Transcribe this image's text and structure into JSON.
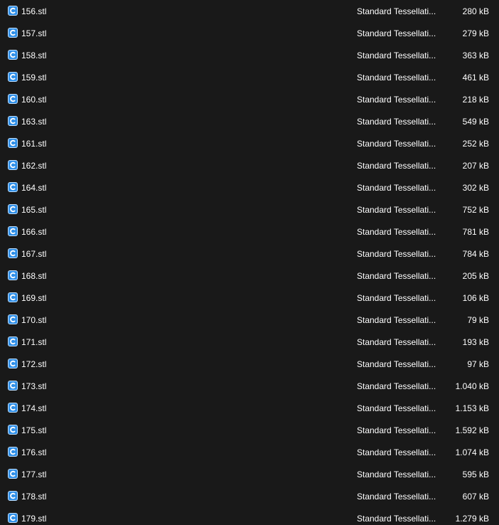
{
  "colors": {
    "background": "#191919",
    "text": "#ffffff",
    "file_icon": "#2f8fe8"
  },
  "file_icon": "stl-file-icon",
  "files": [
    {
      "name": "156.stl",
      "type": "Standard Tessellati...",
      "size": "280 kB"
    },
    {
      "name": "157.stl",
      "type": "Standard Tessellati...",
      "size": "279 kB"
    },
    {
      "name": "158.stl",
      "type": "Standard Tessellati...",
      "size": "363 kB"
    },
    {
      "name": "159.stl",
      "type": "Standard Tessellati...",
      "size": "461 kB"
    },
    {
      "name": "160.stl",
      "type": "Standard Tessellati...",
      "size": "218 kB"
    },
    {
      "name": "163.stl",
      "type": "Standard Tessellati...",
      "size": "549 kB"
    },
    {
      "name": "161.stl",
      "type": "Standard Tessellati...",
      "size": "252 kB"
    },
    {
      "name": "162.stl",
      "type": "Standard Tessellati...",
      "size": "207 kB"
    },
    {
      "name": "164.stl",
      "type": "Standard Tessellati...",
      "size": "302 kB"
    },
    {
      "name": "165.stl",
      "type": "Standard Tessellati...",
      "size": "752 kB"
    },
    {
      "name": "166.stl",
      "type": "Standard Tessellati...",
      "size": "781 kB"
    },
    {
      "name": "167.stl",
      "type": "Standard Tessellati...",
      "size": "784 kB"
    },
    {
      "name": "168.stl",
      "type": "Standard Tessellati...",
      "size": "205 kB"
    },
    {
      "name": "169.stl",
      "type": "Standard Tessellati...",
      "size": "106 kB"
    },
    {
      "name": "170.stl",
      "type": "Standard Tessellati...",
      "size": "79 kB"
    },
    {
      "name": "171.stl",
      "type": "Standard Tessellati...",
      "size": "193 kB"
    },
    {
      "name": "172.stl",
      "type": "Standard Tessellati...",
      "size": "97 kB"
    },
    {
      "name": "173.stl",
      "type": "Standard Tessellati...",
      "size": "1.040 kB"
    },
    {
      "name": "174.stl",
      "type": "Standard Tessellati...",
      "size": "1.153 kB"
    },
    {
      "name": "175.stl",
      "type": "Standard Tessellati...",
      "size": "1.592 kB"
    },
    {
      "name": "176.stl",
      "type": "Standard Tessellati...",
      "size": "1.074 kB"
    },
    {
      "name": "177.stl",
      "type": "Standard Tessellati...",
      "size": "595 kB"
    },
    {
      "name": "178.stl",
      "type": "Standard Tessellati...",
      "size": "607 kB"
    },
    {
      "name": "179.stl",
      "type": "Standard Tessellati...",
      "size": "1.279 kB"
    }
  ]
}
